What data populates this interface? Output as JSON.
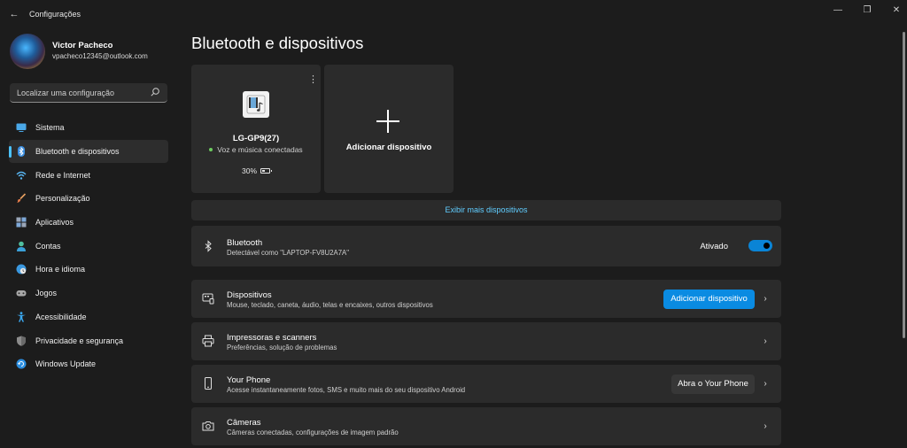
{
  "app": {
    "title": "Configurações",
    "back_glyph": "←"
  },
  "window_controls": {
    "minimize": "—",
    "restore": "❐",
    "close": "✕"
  },
  "profile": {
    "name": "Victor Pacheco",
    "email": "vpacheco12345@outlook.com"
  },
  "search": {
    "placeholder": "Localizar uma configuração",
    "icon": "search-icon"
  },
  "sidebar": {
    "items": [
      {
        "label": "Sistema",
        "icon": "monitor-icon",
        "active": false
      },
      {
        "label": "Bluetooth e dispositivos",
        "icon": "bluetooth-icon",
        "active": true
      },
      {
        "label": "Rede e Internet",
        "icon": "wifi-icon",
        "active": false
      },
      {
        "label": "Personalização",
        "icon": "brush-icon",
        "active": false
      },
      {
        "label": "Aplicativos",
        "icon": "apps-icon",
        "active": false
      },
      {
        "label": "Contas",
        "icon": "person-icon",
        "active": false
      },
      {
        "label": "Hora e idioma",
        "icon": "globe-clock-icon",
        "active": false
      },
      {
        "label": "Jogos",
        "icon": "gamepad-icon",
        "active": false
      },
      {
        "label": "Acessibilidade",
        "icon": "accessibility-icon",
        "active": false
      },
      {
        "label": "Privacidade e segurança",
        "icon": "shield-icon",
        "active": false
      },
      {
        "label": "Windows Update",
        "icon": "update-icon",
        "active": false
      }
    ]
  },
  "page": {
    "title": "Bluetooth e dispositivos"
  },
  "device_card": {
    "name": "LG-GP9(27)",
    "status": "Voz e música conectadas",
    "battery": "30%",
    "more_glyph": "⋮"
  },
  "add_card": {
    "label": "Adicionar dispositivo"
  },
  "more_devices": {
    "label": "Exibir mais dispositivos"
  },
  "bluetooth": {
    "title": "Bluetooth",
    "subtitle": "Detectável como \"LAPTOP-FV8U2A7A\"",
    "toggle_label": "Ativado",
    "toggle_on": true
  },
  "rows": [
    {
      "title": "Dispositivos",
      "subtitle": "Mouse, teclado, caneta, áudio, telas e encaixes, outros dispositivos",
      "icon": "devices-icon",
      "button": "Adicionar dispositivo"
    },
    {
      "title": "Impressoras e scanners",
      "subtitle": "Preferências, solução de problemas",
      "icon": "printer-icon"
    },
    {
      "title": "Your Phone",
      "subtitle": "Acesse instantaneamente fotos, SMS e muito mais do seu dispositivo Android",
      "icon": "phone-icon",
      "button": "Abra o Your Phone"
    },
    {
      "title": "Câmeras",
      "subtitle": "Câmeras conectadas, configurações de imagem padrão",
      "icon": "camera-icon"
    }
  ],
  "chevron_glyph": "›",
  "colors": {
    "background": "#1c1c1c",
    "card": "#2b2b2b",
    "accent": "#4cc2ff",
    "accent_button": "#0a8be2",
    "link": "#60cdff"
  }
}
